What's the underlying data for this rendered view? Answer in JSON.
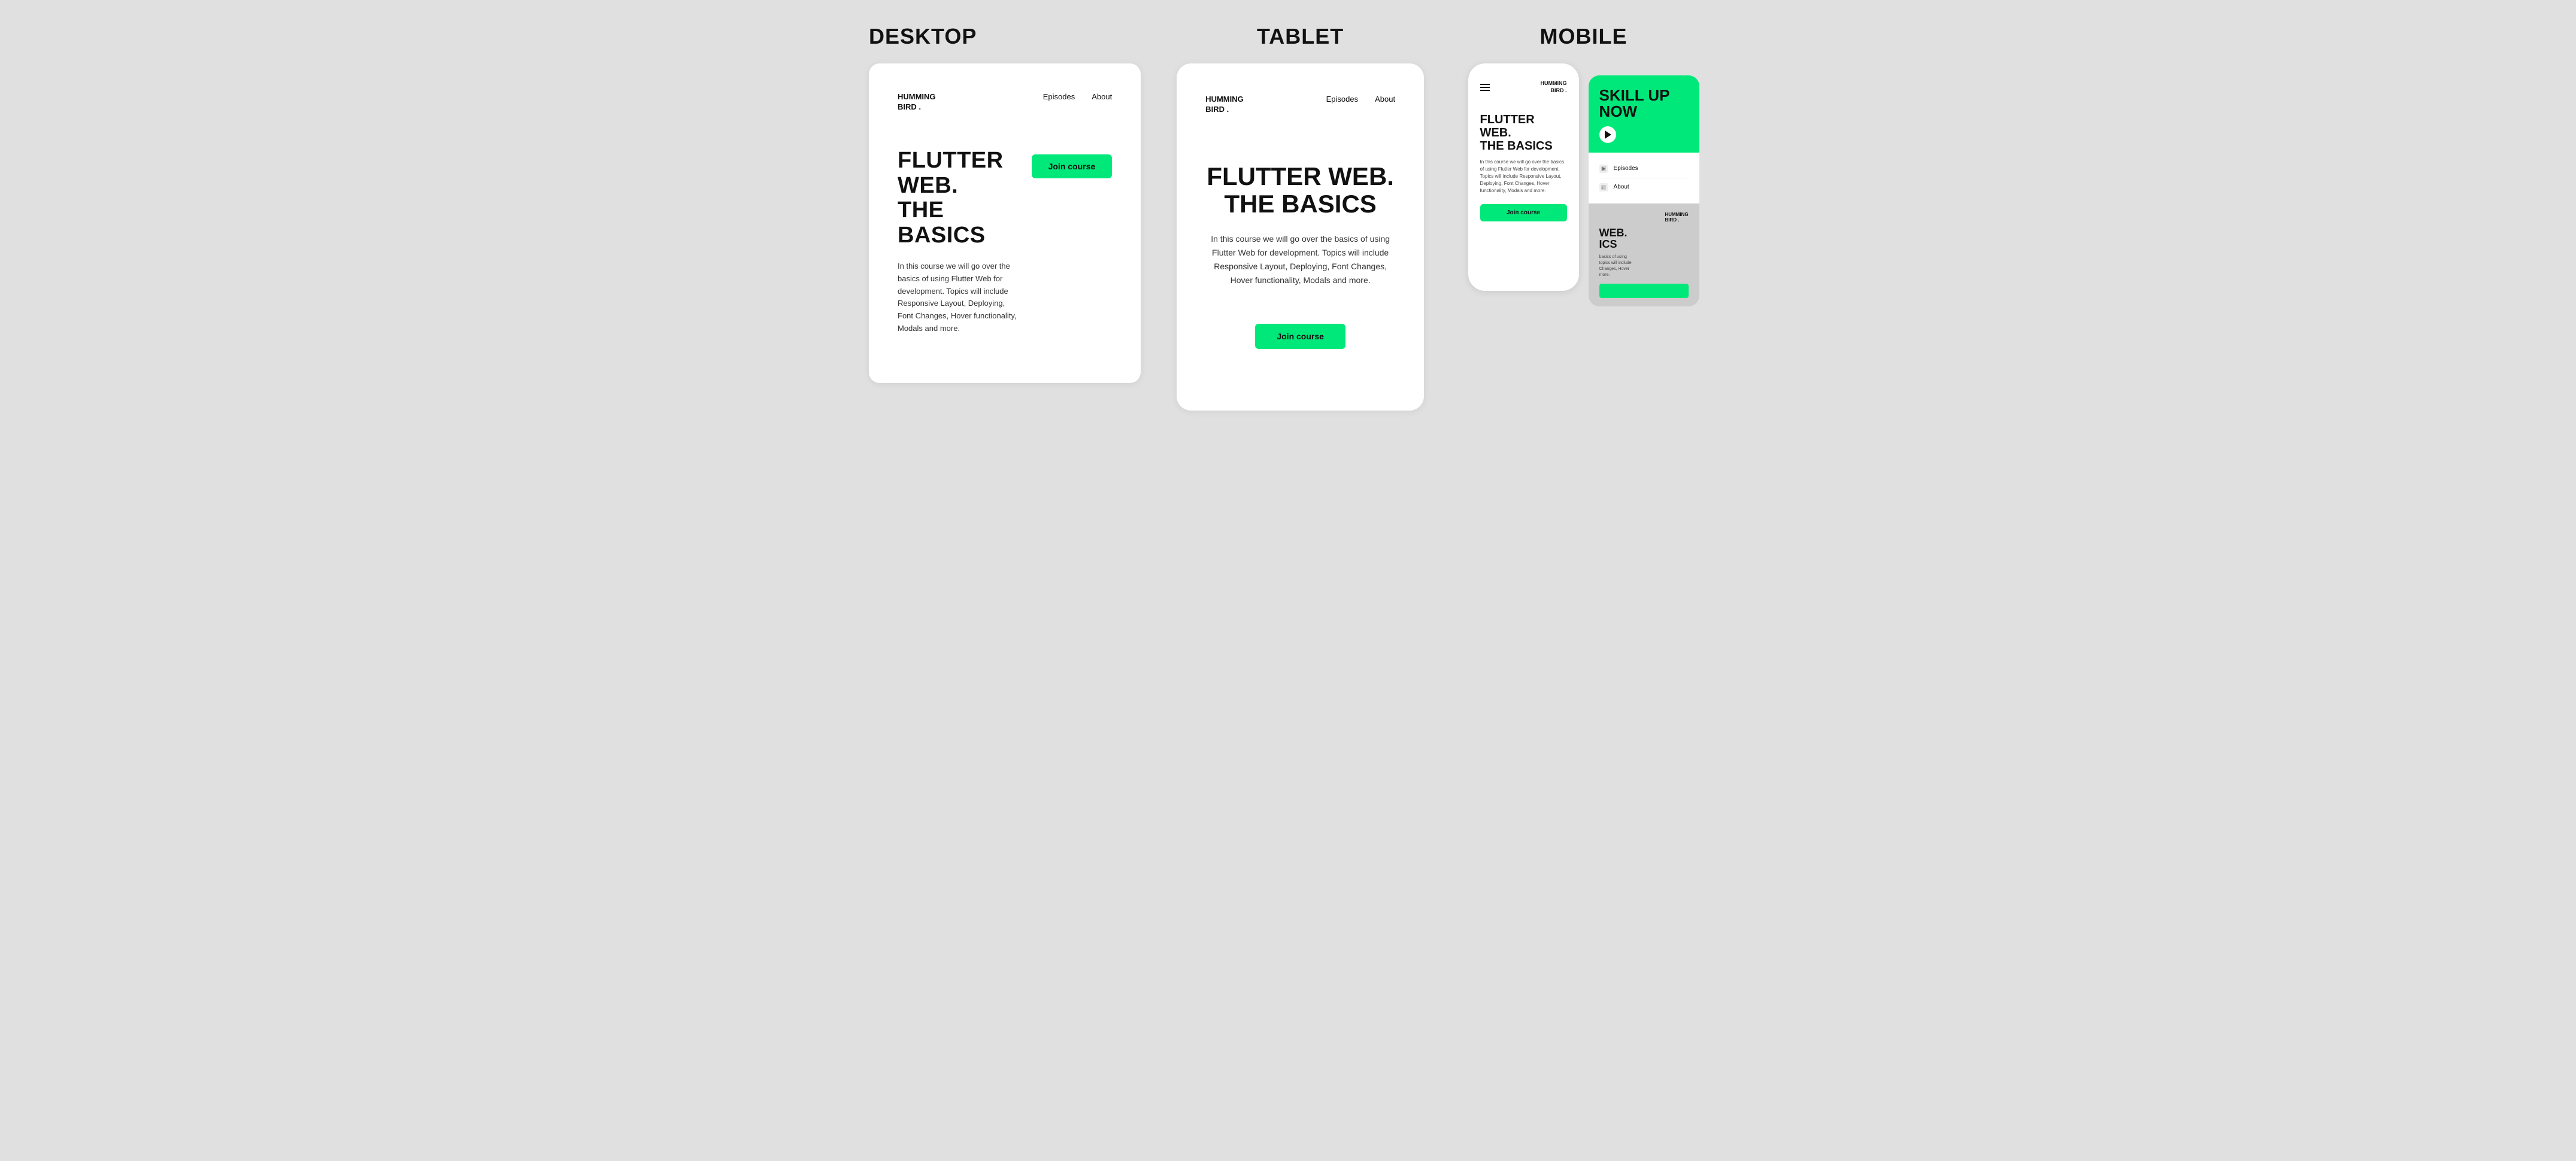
{
  "desktop": {
    "section_label": "DESKTOP",
    "brand": "HUMMING\nBIRD .",
    "nav": {
      "episodes": "Episodes",
      "about": "About"
    },
    "hero": {
      "title": "FLUTTER WEB.\nTHE BASICS",
      "description": "In this course we will go over the basics of using Flutter Web for development. Topics will include Responsive Layout, Deploying, Font Changes, Hover functionality, Modals and more.",
      "join_btn": "Join course"
    }
  },
  "tablet": {
    "section_label": "TABLET",
    "brand": "HUMMING\nBIRD .",
    "nav": {
      "episodes": "Episodes",
      "about": "About"
    },
    "hero": {
      "title": "FLUTTER WEB.\nTHE BASICS",
      "description": "In this course we will go over the basics of using Flutter Web for development. Topics will include Responsive Layout, Deploying, Font Changes, Hover functionality, Modals and more.",
      "join_btn": "Join course"
    }
  },
  "mobile": {
    "section_label": "MOBILE",
    "phone1": {
      "brand": "HUMMING\nBIRD .",
      "hero_title": "FLUTTER WEB.\nTHE BASICS",
      "description": "In this course we will go over the basics of using Flutter Web for development. Topics will include Responsive Layout, Deploying, Font Changes, Hover functionality, Modals and more.",
      "join_btn": "Join course"
    },
    "phone2": {
      "skill_up": "SKILL UP NOW",
      "brand": "HUMMING\nBIRD .",
      "menu_items": [
        "Episodes",
        "About"
      ],
      "partial_title": "WEB.\nICS",
      "partial_desc": "basics of using\nopics will include\nChanges, Hover\nmore."
    }
  }
}
